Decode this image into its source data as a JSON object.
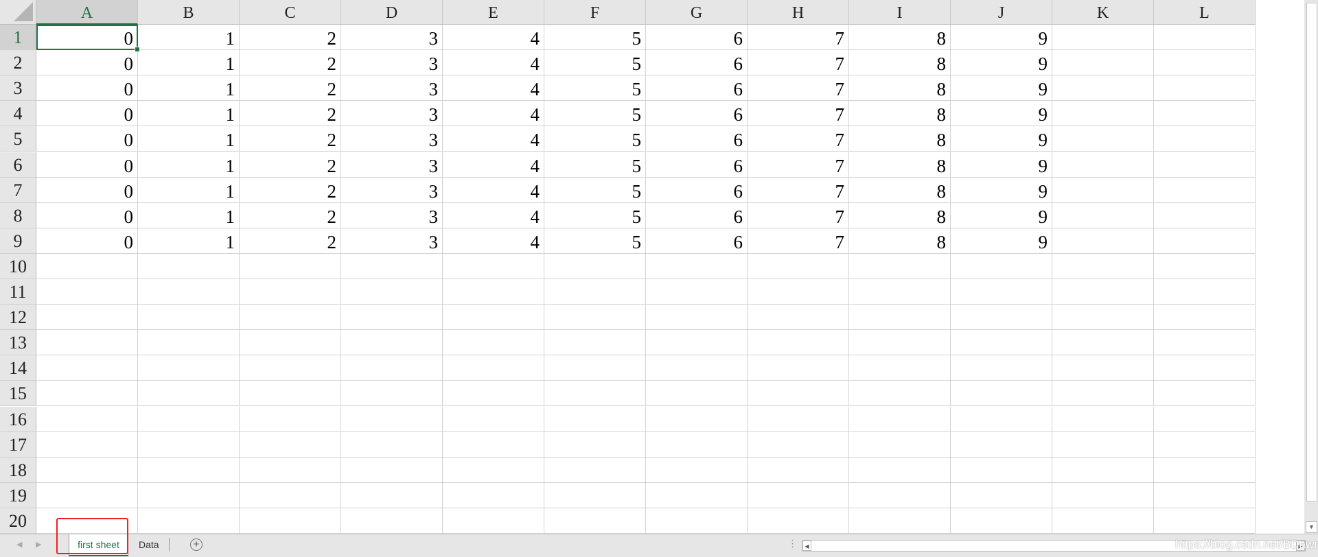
{
  "columns": [
    "A",
    "B",
    "C",
    "D",
    "E",
    "F",
    "G",
    "H",
    "I",
    "J",
    "K",
    "L"
  ],
  "rows": [
    "1",
    "2",
    "3",
    "4",
    "5",
    "6",
    "7",
    "8",
    "9",
    "10",
    "11",
    "12",
    "13",
    "14",
    "15",
    "16",
    "17",
    "18",
    "19",
    "20"
  ],
  "cells": [
    [
      "0",
      "1",
      "2",
      "3",
      "4",
      "5",
      "6",
      "7",
      "8",
      "9"
    ],
    [
      "0",
      "1",
      "2",
      "3",
      "4",
      "5",
      "6",
      "7",
      "8",
      "9"
    ],
    [
      "0",
      "1",
      "2",
      "3",
      "4",
      "5",
      "6",
      "7",
      "8",
      "9"
    ],
    [
      "0",
      "1",
      "2",
      "3",
      "4",
      "5",
      "6",
      "7",
      "8",
      "9"
    ],
    [
      "0",
      "1",
      "2",
      "3",
      "4",
      "5",
      "6",
      "7",
      "8",
      "9"
    ],
    [
      "0",
      "1",
      "2",
      "3",
      "4",
      "5",
      "6",
      "7",
      "8",
      "9"
    ],
    [
      "0",
      "1",
      "2",
      "3",
      "4",
      "5",
      "6",
      "7",
      "8",
      "9"
    ],
    [
      "0",
      "1",
      "2",
      "3",
      "4",
      "5",
      "6",
      "7",
      "8",
      "9"
    ],
    [
      "0",
      "1",
      "2",
      "3",
      "4",
      "5",
      "6",
      "7",
      "8",
      "9"
    ]
  ],
  "active_cell": "A1",
  "sheet_tabs": [
    {
      "label": "first sheet",
      "active": true
    },
    {
      "label": "Data",
      "active": false
    }
  ],
  "watermark": "https://blog.csdn.net/BDawn",
  "accent_color": "#217346",
  "highlight_color": "#f02020"
}
